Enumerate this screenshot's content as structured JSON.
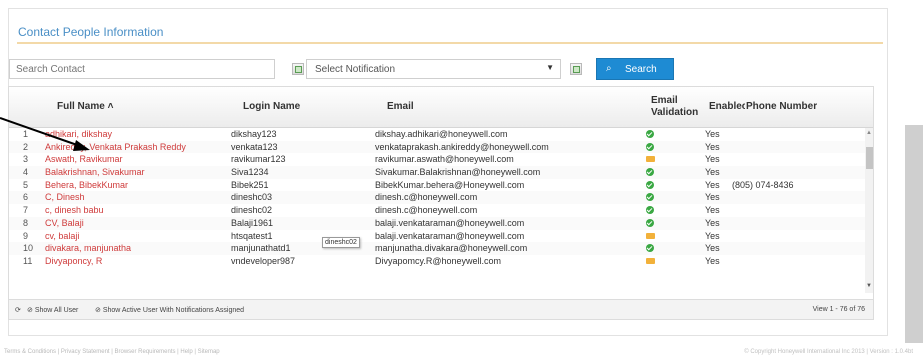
{
  "panel": {
    "title": "Contact People Information"
  },
  "toolbar": {
    "search_placeholder": "Search Contact",
    "notification_select": "Select Notification",
    "select_arrow": "▼",
    "search_button": "Search",
    "search_glyph": "⌕"
  },
  "grid": {
    "headers": {
      "full_name": "Full Name ˄",
      "login_name": "Login Name",
      "email": "Email",
      "email_validation": "Email Validation",
      "enabled": "Enablec",
      "phone": "Phone Number"
    },
    "rows": [
      {
        "num": "1",
        "full_name": "adhikari, dikshay",
        "login": "dikshay123",
        "email": "dikshay.adhikari@honeywell.com",
        "validation": "ok",
        "enabled": "Yes",
        "phone": ""
      },
      {
        "num": "2",
        "full_name": "Ankireddy, Venkata Prakash Reddy",
        "login": "venkata123",
        "email": "venkataprakash.ankireddy@honeywell.com",
        "validation": "ok",
        "enabled": "Yes",
        "phone": ""
      },
      {
        "num": "3",
        "full_name": "Aswath, Ravikumar",
        "login": "ravikumar123",
        "email": "ravikumar.aswath@honeywell.com",
        "validation": "pending",
        "enabled": "Yes",
        "phone": ""
      },
      {
        "num": "4",
        "full_name": "Balakrishnan, Sivakumar",
        "login": "Siva1234",
        "email": "Sivakumar.Balakrishnan@honeywell.com",
        "validation": "ok",
        "enabled": "Yes",
        "phone": ""
      },
      {
        "num": "5",
        "full_name": "Behera, BibekKumar",
        "login": "Bibek251",
        "email": "BibekKumar.behera@Honeywell.com",
        "validation": "ok",
        "enabled": "Yes",
        "phone": "(805) 074-8436"
      },
      {
        "num": "6",
        "full_name": "C, Dinesh",
        "login": "dineshc03",
        "email": "dinesh.c@honeywell.com",
        "validation": "ok",
        "enabled": "Yes",
        "phone": ""
      },
      {
        "num": "7",
        "full_name": "c, dinesh babu",
        "login": "dineshc02",
        "email": "dinesh.c@honeywell.com",
        "validation": "ok",
        "enabled": "Yes",
        "phone": ""
      },
      {
        "num": "8",
        "full_name": "CV, Balaji",
        "login": "Balaji1961",
        "email": "balaji.venkataraman@honeywell.com",
        "validation": "ok",
        "enabled": "Yes",
        "phone": ""
      },
      {
        "num": "9",
        "full_name": "cv, balaji",
        "login": "htsqatest1",
        "email": "balaji.venkataraman@honeywell.com",
        "validation": "pending",
        "enabled": "Yes",
        "phone": ""
      },
      {
        "num": "10",
        "full_name": "divakara, manjunatha",
        "login": "manjunathatd1",
        "email": "manjunatha.divakara@honeywell.com",
        "validation": "ok",
        "enabled": "Yes",
        "phone": ""
      },
      {
        "num": "11",
        "full_name": "Divyaponcy, R",
        "login": "vndeveloper987",
        "email": "Divyapomcy.R@honeywell.com",
        "validation": "pending",
        "enabled": "Yes",
        "phone": ""
      }
    ],
    "tooltip": "dineshc02",
    "scroll_up": "▲",
    "scroll_down": "▼"
  },
  "footer": {
    "show_all": "Show All User",
    "show_active": "Show Active User With Notifications Assigned",
    "view_count": "View 1 - 76 of 76"
  },
  "page_footer": {
    "links": "Terms & Conditions  |  Privacy Statement  |  Browser Requirements  |  Help  |  Sitemap",
    "copyright": "© Copyright Honeywell International Inc 2013 | Version : 1.0.4bt"
  },
  "colors": {
    "accent": "#1e8bd3",
    "name_link": "#cf3b3b",
    "title": "#4a8fc6",
    "valid": "#3aa843",
    "pending": "#f2b13a"
  }
}
